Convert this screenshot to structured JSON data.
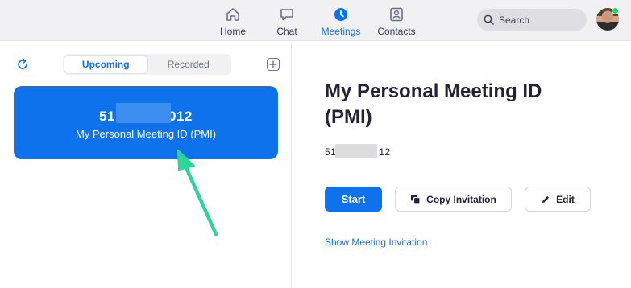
{
  "nav": {
    "items": [
      {
        "label": "Home",
        "icon": "home-icon"
      },
      {
        "label": "Chat",
        "icon": "chat-icon"
      },
      {
        "label": "Meetings",
        "icon": "clock-icon"
      },
      {
        "label": "Contacts",
        "icon": "contacts-icon"
      }
    ],
    "active": "Meetings",
    "search_label": "Search",
    "status_color": "#23d959"
  },
  "left": {
    "tabs": [
      "Upcoming",
      "Recorded"
    ],
    "active_tab": "Upcoming",
    "card": {
      "id_prefix": "51",
      "id_suffix": "012",
      "title": "My Personal Meeting ID (PMI)"
    }
  },
  "right": {
    "title": "My Personal Meeting ID (PMI)",
    "id_prefix": "51",
    "id_suffix": "12",
    "start_label": "Start",
    "copy_label": "Copy Invitation",
    "edit_label": "Edit",
    "show_invite_label": "Show Meeting Invitation"
  },
  "colors": {
    "accent": "#0e72ed",
    "annotation_arrow": "#2fd49a"
  }
}
